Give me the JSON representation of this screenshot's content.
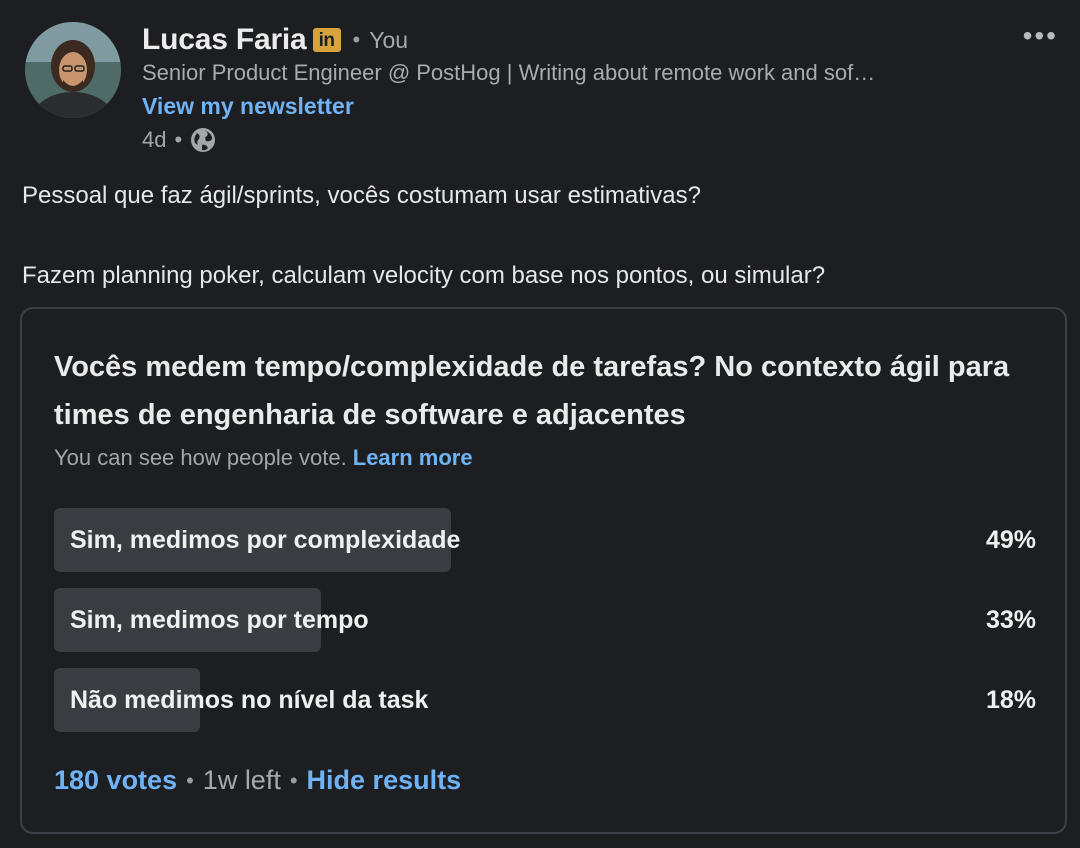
{
  "author": {
    "name": "Lucas Faria",
    "badge": "in",
    "relation": "You",
    "headline": "Senior Product Engineer @ PostHog | Writing about remote work and sof…",
    "newsletter_link": "View my newsletter",
    "age": "4d"
  },
  "more_icon": "ellipsis-icon",
  "post": {
    "paragraphs": [
      "Pessoal que faz ágil/sprints, vocês costumam usar estimativas?",
      "Fazem planning poker, calculam velocity com base nos pontos, ou simular?"
    ]
  },
  "poll": {
    "question": "Vocês medem tempo/complexidade de tarefas? No contexto ágil para times de engenharia de software e adjacentes",
    "visibility_note": "You can see how people vote.",
    "learn_more": "Learn more",
    "options": [
      {
        "label": "Sim, medimos por complexidade",
        "percent": "49%",
        "fraction": 0.49
      },
      {
        "label": "Sim, medimos por tempo",
        "percent": "33%",
        "fraction": 0.33
      },
      {
        "label": "Não medimos no nível da task",
        "percent": "18%",
        "fraction": 0.18
      }
    ],
    "votes": "180 votes",
    "time_left": "1w left",
    "hide_results": "Hide results"
  },
  "colors": {
    "background": "#1c1e22",
    "link": "#70b3f5",
    "bar_fill": "#3a3c41",
    "badge": "#d8a33c"
  }
}
